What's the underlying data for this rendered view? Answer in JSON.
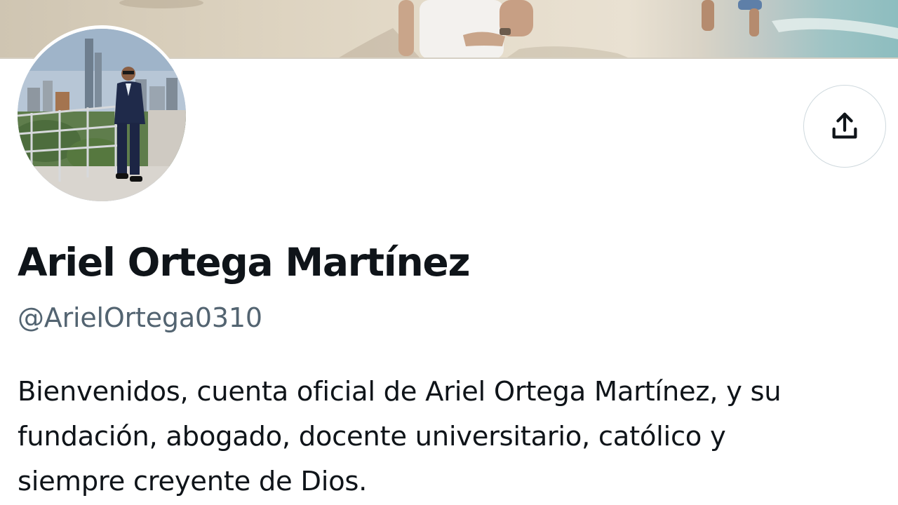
{
  "profile": {
    "display_name": "Ariel Ortega Martínez",
    "handle": "@ArielOrtega0310",
    "bio": "Bienvenidos, cuenta oficial de Ariel Ortega Martínez, y su\nfundación, abogado, docente universitario, católico y\nsiempre creyente de Dios."
  },
  "banner": {
    "icon": "beach-photo"
  },
  "avatar": {
    "icon": "profile-photo"
  },
  "share_button": {
    "icon": "share-upload-icon"
  },
  "colors": {
    "text_primary": "#0f1419",
    "text_secondary": "#536471",
    "button_border": "#cfd9de"
  }
}
